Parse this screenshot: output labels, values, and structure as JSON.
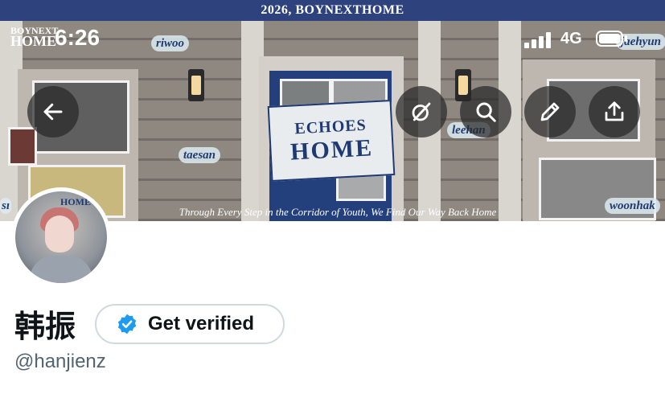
{
  "status_bar": {
    "time": "6:26",
    "network": "4G"
  },
  "banner": {
    "top_text": "2026, BOYNEXTHOME",
    "logo_line1": "ECHOES",
    "logo_line2": "HOME",
    "tagline": "Through Every Step in the Corridor of Youth, We Find Our Way Back Home",
    "corner_logo_top": "BOYNEXT",
    "corner_logo_bottom": "HOME",
    "stickers": [
      "riwoo",
      "taesan",
      "leehan",
      "woonhak",
      "sungho",
      "jaehyun"
    ]
  },
  "toolbar": {
    "back": "back",
    "grok": "grok",
    "search": "search",
    "edit": "edit",
    "share": "share"
  },
  "profile": {
    "name": "韩振",
    "verify_label": "Get verified",
    "handle": "@hanjienz",
    "avatar_text": "HOME"
  },
  "colors": {
    "accent": "#1d9bf0",
    "banner_strip": "#2e437e",
    "text": "#0f1419",
    "muted": "#536471"
  }
}
